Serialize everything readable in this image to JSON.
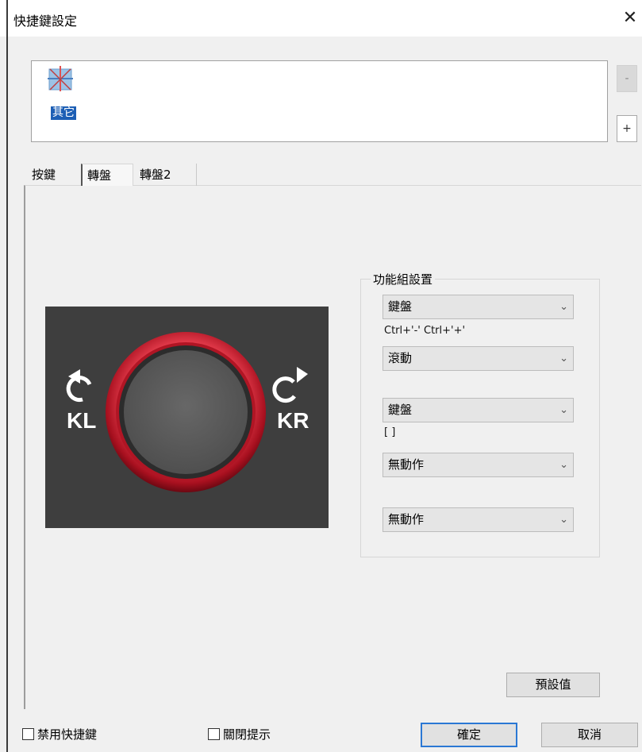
{
  "window": {
    "title": "快捷鍵設定",
    "close_glyph": "✕"
  },
  "profile": {
    "app_label": "其它",
    "minus_label": "-",
    "plus_label": "+"
  },
  "tabs": [
    {
      "label": "按鍵"
    },
    {
      "label": "轉盤"
    },
    {
      "label": "轉盤2"
    }
  ],
  "active_tab": "轉盤",
  "dial": {
    "left_label": "KL",
    "right_label": "KR"
  },
  "function_group": {
    "title": "功能組設置",
    "selects": [
      {
        "value": "鍵盤",
        "sub": "Ctrl+'-'  Ctrl+'+'"
      },
      {
        "value": "滾動",
        "sub": ""
      },
      {
        "value": "鍵盤",
        "sub": "[ ]"
      },
      {
        "value": "無動作",
        "sub": ""
      },
      {
        "value": "無動作",
        "sub": ""
      }
    ]
  },
  "buttons": {
    "default_label": "預設值",
    "ok_label": "確定",
    "cancel_label": "取消"
  },
  "checkboxes": {
    "disable_shortcuts": "禁用快捷鍵",
    "close_tips": "關閉提示"
  },
  "colors": {
    "accent": "#2b78d4",
    "selection": "#1d5fb5",
    "ring": "#c0182a",
    "dial_bg": "#3e3e3e"
  }
}
